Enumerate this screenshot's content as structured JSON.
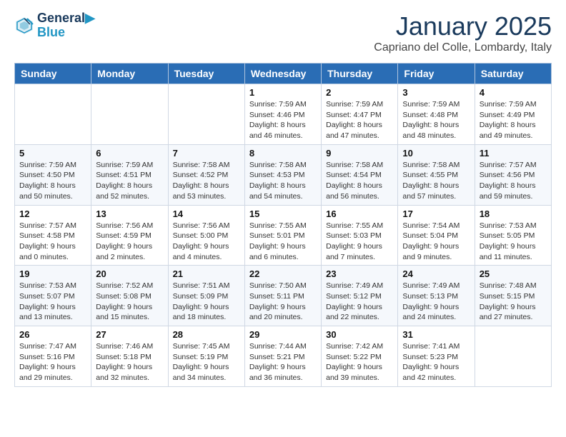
{
  "header": {
    "logo_line1": "General",
    "logo_line2": "Blue",
    "month": "January 2025",
    "location": "Capriano del Colle, Lombardy, Italy"
  },
  "weekdays": [
    "Sunday",
    "Monday",
    "Tuesday",
    "Wednesday",
    "Thursday",
    "Friday",
    "Saturday"
  ],
  "weeks": [
    [
      {
        "day": "",
        "info": ""
      },
      {
        "day": "",
        "info": ""
      },
      {
        "day": "",
        "info": ""
      },
      {
        "day": "1",
        "info": "Sunrise: 7:59 AM\nSunset: 4:46 PM\nDaylight: 8 hours\nand 46 minutes."
      },
      {
        "day": "2",
        "info": "Sunrise: 7:59 AM\nSunset: 4:47 PM\nDaylight: 8 hours\nand 47 minutes."
      },
      {
        "day": "3",
        "info": "Sunrise: 7:59 AM\nSunset: 4:48 PM\nDaylight: 8 hours\nand 48 minutes."
      },
      {
        "day": "4",
        "info": "Sunrise: 7:59 AM\nSunset: 4:49 PM\nDaylight: 8 hours\nand 49 minutes."
      }
    ],
    [
      {
        "day": "5",
        "info": "Sunrise: 7:59 AM\nSunset: 4:50 PM\nDaylight: 8 hours\nand 50 minutes."
      },
      {
        "day": "6",
        "info": "Sunrise: 7:59 AM\nSunset: 4:51 PM\nDaylight: 8 hours\nand 52 minutes."
      },
      {
        "day": "7",
        "info": "Sunrise: 7:58 AM\nSunset: 4:52 PM\nDaylight: 8 hours\nand 53 minutes."
      },
      {
        "day": "8",
        "info": "Sunrise: 7:58 AM\nSunset: 4:53 PM\nDaylight: 8 hours\nand 54 minutes."
      },
      {
        "day": "9",
        "info": "Sunrise: 7:58 AM\nSunset: 4:54 PM\nDaylight: 8 hours\nand 56 minutes."
      },
      {
        "day": "10",
        "info": "Sunrise: 7:58 AM\nSunset: 4:55 PM\nDaylight: 8 hours\nand 57 minutes."
      },
      {
        "day": "11",
        "info": "Sunrise: 7:57 AM\nSunset: 4:56 PM\nDaylight: 8 hours\nand 59 minutes."
      }
    ],
    [
      {
        "day": "12",
        "info": "Sunrise: 7:57 AM\nSunset: 4:58 PM\nDaylight: 9 hours\nand 0 minutes."
      },
      {
        "day": "13",
        "info": "Sunrise: 7:56 AM\nSunset: 4:59 PM\nDaylight: 9 hours\nand 2 minutes."
      },
      {
        "day": "14",
        "info": "Sunrise: 7:56 AM\nSunset: 5:00 PM\nDaylight: 9 hours\nand 4 minutes."
      },
      {
        "day": "15",
        "info": "Sunrise: 7:55 AM\nSunset: 5:01 PM\nDaylight: 9 hours\nand 6 minutes."
      },
      {
        "day": "16",
        "info": "Sunrise: 7:55 AM\nSunset: 5:03 PM\nDaylight: 9 hours\nand 7 minutes."
      },
      {
        "day": "17",
        "info": "Sunrise: 7:54 AM\nSunset: 5:04 PM\nDaylight: 9 hours\nand 9 minutes."
      },
      {
        "day": "18",
        "info": "Sunrise: 7:53 AM\nSunset: 5:05 PM\nDaylight: 9 hours\nand 11 minutes."
      }
    ],
    [
      {
        "day": "19",
        "info": "Sunrise: 7:53 AM\nSunset: 5:07 PM\nDaylight: 9 hours\nand 13 minutes."
      },
      {
        "day": "20",
        "info": "Sunrise: 7:52 AM\nSunset: 5:08 PM\nDaylight: 9 hours\nand 15 minutes."
      },
      {
        "day": "21",
        "info": "Sunrise: 7:51 AM\nSunset: 5:09 PM\nDaylight: 9 hours\nand 18 minutes."
      },
      {
        "day": "22",
        "info": "Sunrise: 7:50 AM\nSunset: 5:11 PM\nDaylight: 9 hours\nand 20 minutes."
      },
      {
        "day": "23",
        "info": "Sunrise: 7:49 AM\nSunset: 5:12 PM\nDaylight: 9 hours\nand 22 minutes."
      },
      {
        "day": "24",
        "info": "Sunrise: 7:49 AM\nSunset: 5:13 PM\nDaylight: 9 hours\nand 24 minutes."
      },
      {
        "day": "25",
        "info": "Sunrise: 7:48 AM\nSunset: 5:15 PM\nDaylight: 9 hours\nand 27 minutes."
      }
    ],
    [
      {
        "day": "26",
        "info": "Sunrise: 7:47 AM\nSunset: 5:16 PM\nDaylight: 9 hours\nand 29 minutes."
      },
      {
        "day": "27",
        "info": "Sunrise: 7:46 AM\nSunset: 5:18 PM\nDaylight: 9 hours\nand 32 minutes."
      },
      {
        "day": "28",
        "info": "Sunrise: 7:45 AM\nSunset: 5:19 PM\nDaylight: 9 hours\nand 34 minutes."
      },
      {
        "day": "29",
        "info": "Sunrise: 7:44 AM\nSunset: 5:21 PM\nDaylight: 9 hours\nand 36 minutes."
      },
      {
        "day": "30",
        "info": "Sunrise: 7:42 AM\nSunset: 5:22 PM\nDaylight: 9 hours\nand 39 minutes."
      },
      {
        "day": "31",
        "info": "Sunrise: 7:41 AM\nSunset: 5:23 PM\nDaylight: 9 hours\nand 42 minutes."
      },
      {
        "day": "",
        "info": ""
      }
    ]
  ]
}
